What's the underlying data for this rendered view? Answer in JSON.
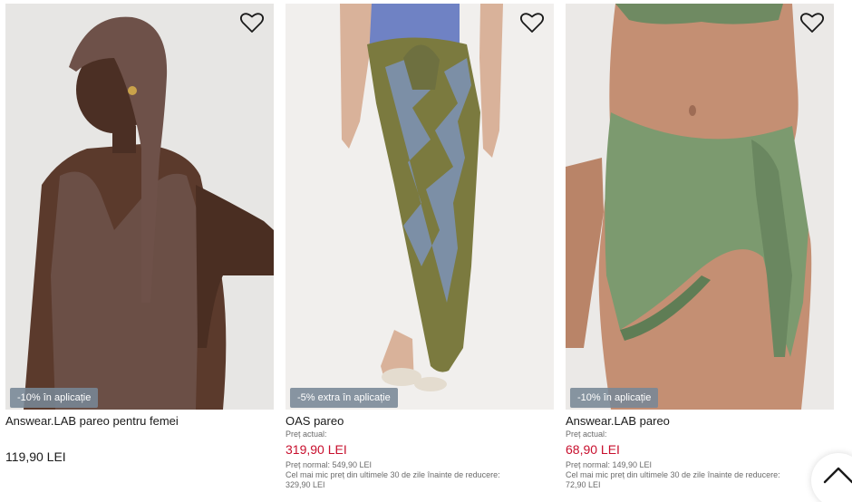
{
  "products": [
    {
      "title": "Answear.LAB pareo pentru femei",
      "badge": "-10% în aplicație",
      "price": "119,90 LEI"
    },
    {
      "title": "OAS pareo",
      "badge": "-5% extra în aplicație",
      "current_label": "Preț actual:",
      "price": "319,90 LEI",
      "old_price": "Preț normal: 549,90 LEI",
      "lowest_label": "Cel mai mic preț din ultimele 30 de zile înainte de reducere:",
      "lowest_value": "329,90 LEI"
    },
    {
      "title": "Answear.LAB pareo",
      "badge": "-10% în aplicație",
      "current_label": "Preț actual:",
      "price": "68,90 LEI",
      "old_price": "Preț normal: 149,90 LEI",
      "lowest_label": "Cel mai mic preț din ultimele 30 de zile înainte de reducere:",
      "lowest_value": "72,90 LEI"
    }
  ],
  "icons": {
    "favorite": "heart-outline-icon",
    "scroll_top": "chevron-up-icon"
  },
  "colors": {
    "sale_price": "#c8102e",
    "badge_bg": "#7a8896",
    "muted_text": "#6b6b6b"
  }
}
